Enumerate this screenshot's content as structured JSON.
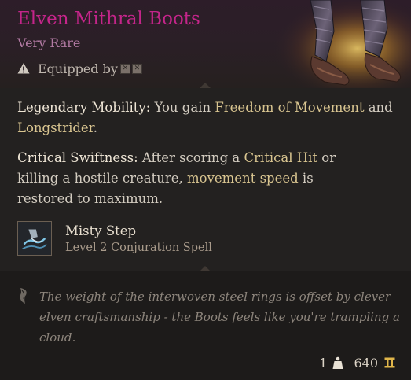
{
  "item": {
    "name": "Elven Mithral Boots",
    "rarity": "Very Rare",
    "equipped_label": "Equipped by",
    "title_color": "#c4258a",
    "rarity_color": "#b27aa3",
    "art_icon": "mithral-boots-art"
  },
  "passives": [
    {
      "name": "Legendary Mobility:",
      "text_a": " You gain ",
      "keyword_1": "Freedom of Movement",
      "text_b": " and ",
      "keyword_2": "Longstrider",
      "text_c": "."
    },
    {
      "name": "Critical Swiftness:",
      "text_a": " After scoring a ",
      "keyword_1": "Critical Hit",
      "text_b": " or killing a hostile creature, ",
      "keyword_2": "movement speed",
      "text_c": " is restored to maximum."
    }
  ],
  "spell": {
    "name": "Misty Step",
    "subtitle": "Level 2 Conjuration Spell",
    "icon": "misty-step-icon"
  },
  "flavor": {
    "text": "The weight of the interwoven steel rings is offset by clever elven craftsmanship - the Boots feels like you're trampling a cloud.",
    "icon": "quill-icon"
  },
  "footer": {
    "weight": "1",
    "weight_icon": "weight-icon",
    "value": "640",
    "value_icon": "gold-coin-icon"
  },
  "colors": {
    "keyword": "#d9c590",
    "passive_name": "#efe6d6"
  }
}
